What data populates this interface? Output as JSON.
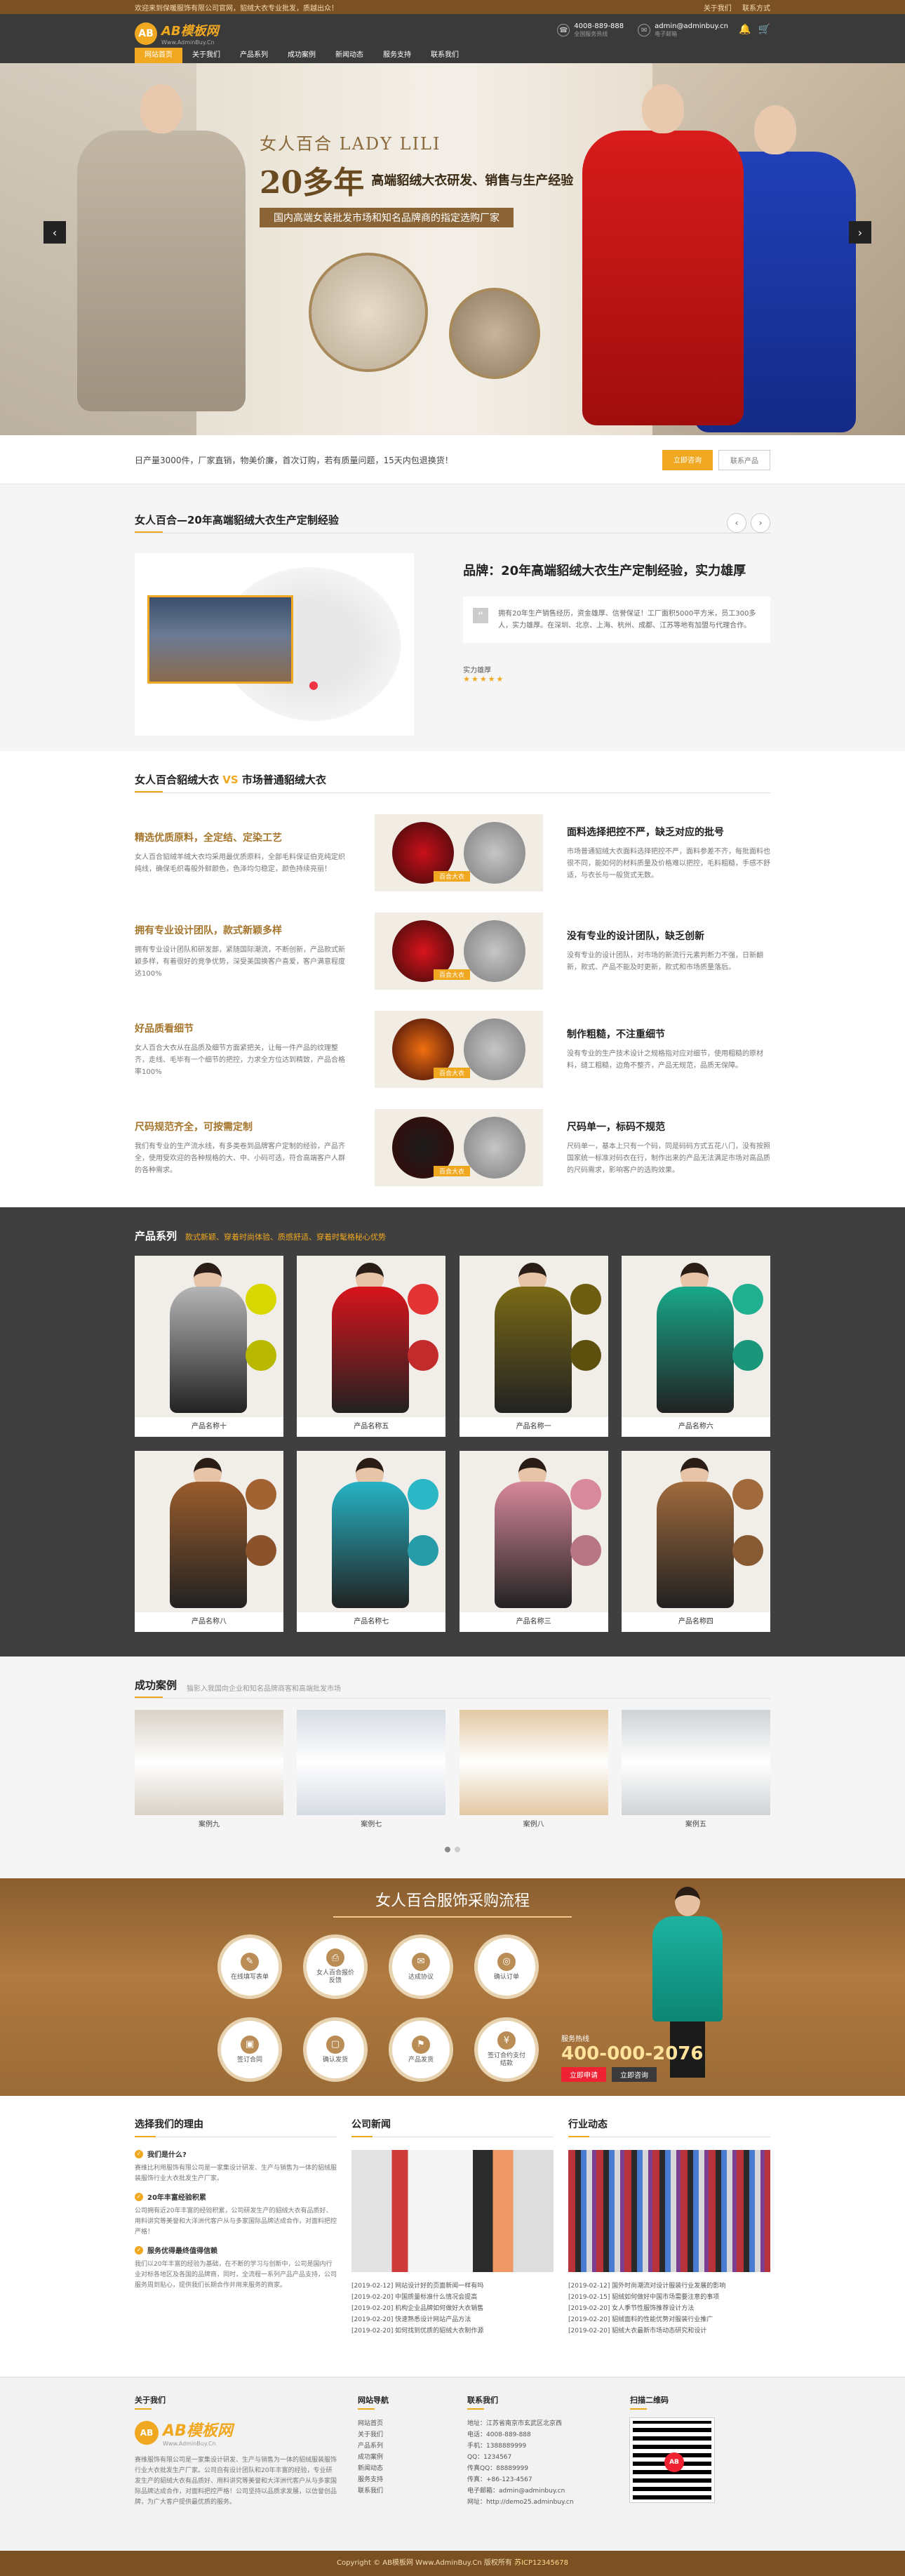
{
  "topbar": {
    "welcome": "欢迎来到保暖服饰有限公司官网，貂绒大衣专业批发，质越出众！",
    "links": [
      "关于我们",
      "联系方式"
    ]
  },
  "header": {
    "logo_main": "AB模板网",
    "logo_sub": "Www.AdminBuy.Cn",
    "phone": "4008-889-888",
    "phone_sub": "全国服务热线",
    "email": "admin@adminbuy.cn",
    "email_sub": "电子邮箱",
    "nav": [
      "网站首页",
      "关于我们",
      "产品系列",
      "成功案例",
      "新闻动态",
      "服务支持",
      "联系我们"
    ]
  },
  "banner": {
    "title_cn": "女人百合",
    "title_en": "LADY LILI",
    "years": "20多年",
    "headline": "高端貂绒大衣研发、销售与生产经验",
    "sub": "国内高端女装批发市场和知名品牌商的指定选购厂家",
    "prev": "‹",
    "next": "›"
  },
  "info": {
    "text": "日产量3000件，厂家直销，物美价廉，首次订购，若有质量问题，15天内包退换货！",
    "btn_primary": "立即咨询",
    "btn_secondary": "联系产品"
  },
  "about": {
    "title": "女人百合—20年高端貂绒大衣生产定制经验",
    "brand": "品牌：20年高端貂绒大衣生产定制经验，实力雄厚",
    "quote": "拥有20年生产销售经历，资金雄厚、信誉保证！工厂面积5000平方米，员工300多人，实力雄厚。在深圳、北京、上海、杭州、成都、江苏等地有加盟与代理合作。",
    "foot": "实力雄厚",
    "stars": "★★★★★"
  },
  "compare": {
    "title_a": "女人百合貂绒大衣",
    "vs": "VS",
    "title_b": "市场普通貂绒大衣",
    "rows": [
      {
        "good_title": "精选优质原料，全定结、定染工艺",
        "good_text": "女人百合貂绒羊绒大衣均采用最优质原料，全部毛料保证伯克纯定织纯线，确保毛织毒般外鲜颜色，色泽均匀稳定，颜色持续亮丽！",
        "tag": "百合大衣",
        "bad_title": "面料选择把控不严，缺乏对应的批号",
        "bad_text": "市场普通貂绒大衣面料选择把控不严，面料参差不齐，每批面料也很不同，能如何的材料质量及价格难以把控，毛料粗糙，手感不舒适，与衣长与一般货式无数。",
        "c1": "#c9101a"
      },
      {
        "good_title": "拥有专业设计团队，款式新颖多样",
        "good_text": "拥有专业设计团队和研发部，紧随国际潮流，不断创新，产品款式新颖多样，有着很好的竞争优势，深受美国换客户喜爱，客户满意程度达100%",
        "tag": "百合大衣",
        "bad_title": "没有专业的设计团队，缺乏创新",
        "bad_text": "没有专业的设计团队，对市场的新流行元素判断力不强，日新翻新，款式、产品不能及时更新，款式和市场质量落后。",
        "c1": "#d8141c"
      },
      {
        "good_title": "好品质看细节",
        "good_text": "女人百合大衣从在品质及细节方面紧把关，让每一件产品的纹理整齐，走线、毛毕有一个细节的把控，力求全方位达到精致，产品合格率100%",
        "tag": "百合大衣",
        "bad_title": "制作粗糙，不注重细节",
        "bad_text": "没有专业的生产技术设计之规格指对应对细节，使用粗糙的原材料，缝工粗糙，边角不整齐，产品无规范，品质无保障。",
        "c1": "#f07010"
      },
      {
        "good_title": "尺码规范齐全，可按需定制",
        "good_text": "我们有专业的生产流水线，有多类卷到品牌客户定制的经验，产品齐全，使用受欢迎的各种规格的大、中、小码可选，符合高端客户人群的各种需求。",
        "tag": "百合大衣",
        "bad_title": "尺码单一，标码不规范",
        "bad_text": "尺码单一，基本上只有一个码，同是码码方式五花八门，没有按照国家统一标准对码衣在行，制作出来的产品无法满足市场对高品质的尺码需求，影响客户的选购效果。",
        "c1": "#1b1b1b"
      }
    ]
  },
  "products": {
    "title": "产品系列",
    "tagline": "款式新颖、穿着时尚体验、质感舒适、穿着时髦格秘心优势",
    "items": [
      {
        "name": "产品名称十",
        "coat": "#b5b5b5",
        "sw": "#d8d800"
      },
      {
        "name": "产品名称五",
        "coat": "#d8141c",
        "sw": "#e33333"
      },
      {
        "name": "产品名称一",
        "coat": "#7a6a14",
        "sw": "#6d5d10"
      },
      {
        "name": "产品名称六",
        "coat": "#18a88a",
        "sw": "#1fb090"
      },
      {
        "name": "产品名称八",
        "coat": "#9a5c2c",
        "sw": "#a26232"
      },
      {
        "name": "产品名称七",
        "coat": "#26b3c4",
        "sw": "#2bb7c6"
      },
      {
        "name": "产品名称三",
        "coat": "#d7879b",
        "sw": "#d88a9c"
      },
      {
        "name": "产品名称四",
        "coat": "#a06a3c",
        "sw": "#a06a3c"
      }
    ]
  },
  "cases": {
    "title": "成功案例",
    "sub": "猫影入我国向企业和知名品牌商客和高端批发市场",
    "items": [
      {
        "name": "案例九",
        "c": "#d9d2c6"
      },
      {
        "name": "案例七",
        "c": "#d6dce4"
      },
      {
        "name": "案例八",
        "c": "#e3c8a3"
      },
      {
        "name": "案例五",
        "c": "#cfd3d6"
      }
    ]
  },
  "process": {
    "title": "女人百合服饰采购流程",
    "steps": [
      {
        "icon": "✎",
        "label": "在线填写表单"
      },
      {
        "icon": "⎙",
        "label": "女人百合报价反馈"
      },
      {
        "icon": "✉",
        "label": "达成协议"
      },
      {
        "icon": "◎",
        "label": "确认订单"
      },
      {
        "icon": "▣",
        "label": "签订合同"
      },
      {
        "icon": "▢",
        "label": "确认发货"
      },
      {
        "icon": "⚑",
        "label": "产品发货"
      },
      {
        "icon": "¥",
        "label": "签订合约支付结款"
      }
    ],
    "tel_label": "服务热线",
    "tel": "400-000-2076",
    "btn1": "立即申请",
    "btn2": "立即咨询"
  },
  "why": {
    "title": "选择我们的理由",
    "items": [
      {
        "q": "我们是什么?",
        "a": "赛维比利用服饰有限公司是一家集设计研发、生产与销售为一体的貂绒服装服饰行业大衣批发生产厂家。"
      },
      {
        "q": "20年丰富经验积累",
        "a": "公司拥有近20年丰富的经验积累，公司研发生产的貂绒大衣有品质好、用料讲究等美誉和大洋洲代客户从与多家国际品牌达成合作，对面料把控严格！"
      },
      {
        "q": "服务优得最终值得信赖",
        "a": "我们以20年丰富的经验为基础，在不断的学习与创新中，公司是国内行业对标各地区及各国的品牌商，同时，全流程一系列产品产品支持，公司服务周到贴心，提供我们长期合作并用来服务的商家。"
      }
    ]
  },
  "company_news": {
    "title": "公司新闻",
    "items": [
      "[2019-02-12] 网站设计好的页面新闻一样有吗",
      "[2019-02-20] 中国质量标准什么情况会提高",
      "[2019-02-20] 机构企业品牌如何做好大衣销售",
      "[2019-02-20] 快速熟悉设计网站产品方法",
      "[2019-02-20] 如何找到优质的貂绒大衣制作源"
    ]
  },
  "industry_news": {
    "title": "行业动态",
    "items": [
      "[2019-02-12] 国外时尚潮流对设计服装行业发展的影响",
      "[2019-02-15] 貂绒如何做好中国市场需要注意的事项",
      "[2019-02-20] 女人季节性服饰推荐设计方法",
      "[2019-02-20] 貂绒面料的性能优势对服装行业推广",
      "[2019-02-20] 貂绒大衣最新市场动态研究和设计"
    ]
  },
  "footer": {
    "about_title": "关于我们",
    "about_text": "赛维服饰有限公司是一家集设计研发、生产与销售为一体的貂绒服装服饰行业大衣批发生产厂家。公司自有设计团队和20年丰富的经验，专业研发生产的貂绒大衣有品质好、用料讲究等美誉和大洋洲代客户从与多家国际品牌达成合作，对面料把控严格！公司坚持以品质求发展，以信誉创品牌，为广大客户提供最优质的服务。",
    "nav_title": "网站导航",
    "nav": [
      "网站首页",
      "关于我们",
      "产品系列",
      "成功案例",
      "新闻动态",
      "服务支持",
      "联系我们"
    ],
    "contact_title": "联系我们",
    "contact": [
      "地址：江苏省南京市玄武区北京西",
      "电话：4008-889-888",
      "手机：1388889999",
      "QQ：1234567",
      "传真QQ：88889999",
      "传真：+86-123-4567",
      "电子邮箱：admin@adminbuy.cn",
      "网址：http://demo25.adminbuy.cn"
    ],
    "qr_title": "扫描二维码",
    "copyright": "Copyright © AB模板网 Www.AdminBuy.Cn 版权所有",
    "icp": "苏ICP12345678"
  }
}
